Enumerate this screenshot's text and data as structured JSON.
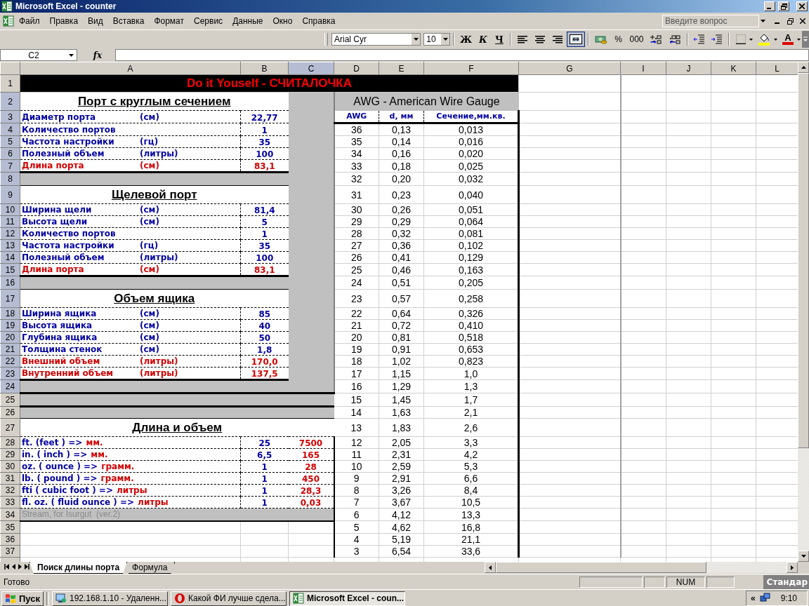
{
  "window": {
    "title": "Microsoft Excel - counter"
  },
  "menu": [
    "Файл",
    "Правка",
    "Вид",
    "Вставка",
    "Формат",
    "Сервис",
    "Данные",
    "Окно",
    "Справка"
  ],
  "help_box": {
    "placeholder": "Введите вопрос"
  },
  "toolbar": {
    "font": "Arial Cyr",
    "size": "10",
    "font_color_label": "А",
    "toggles": [
      {
        "kind": "bold",
        "label": "Ж",
        "on": false
      },
      {
        "kind": "italic",
        "label": "К",
        "on": false
      },
      {
        "kind": "underline",
        "label": "Ч",
        "on": false
      },
      {
        "kind": "align_left",
        "on": false
      },
      {
        "kind": "align_center",
        "on": false
      },
      {
        "kind": "align_right",
        "on": false
      },
      {
        "kind": "merge",
        "on": true
      }
    ],
    "number_buttons": [
      {
        "kind": "currency"
      },
      {
        "kind": "text",
        "label": "%"
      },
      {
        "kind": "text",
        "label": "000"
      },
      {
        "kind": "increase_decimal"
      },
      {
        "kind": "decrease_decimal"
      }
    ]
  },
  "formula_bar": {
    "name_box": "C2",
    "function_label": "fx"
  },
  "sheet": {
    "columns": [
      {
        "label": "A",
        "selected": false
      },
      {
        "label": "B",
        "selected": false
      },
      {
        "label": "C",
        "selected": true
      },
      {
        "label": "D",
        "selected": false
      },
      {
        "label": "E",
        "selected": false
      },
      {
        "label": "F",
        "selected": false
      },
      {
        "label": "G",
        "selected": false
      },
      {
        "label": "I",
        "selected": false
      },
      {
        "label": "J",
        "selected": false
      },
      {
        "label": "K",
        "selected": false
      },
      {
        "label": "L",
        "selected": false
      }
    ],
    "rows": [
      {
        "number": "1",
        "selected": false,
        "kind": "banner",
        "text": "Do it Youself - СЧИТАЛОЧКА"
      },
      {
        "number": "2",
        "selected": true,
        "kind": "heading",
        "text": "Порт с круглым сечением"
      },
      {
        "number": "3",
        "selected": true,
        "kind": "param",
        "label": "Диаметр порта",
        "unit": "(см)",
        "value": "22,77",
        "color": "#0000a0"
      },
      {
        "number": "4",
        "selected": true,
        "kind": "param",
        "label": "Количество портов",
        "value": "1",
        "color": "#0000a0"
      },
      {
        "number": "5",
        "selected": true,
        "kind": "param",
        "label": "Частота настройки",
        "unit": "(гц)",
        "value": "35",
        "color": "#0000a0"
      },
      {
        "number": "6",
        "selected": true,
        "kind": "param",
        "label": "Полезный объем",
        "unit": "(литры)",
        "value": "100",
        "color": "#0000a0"
      },
      {
        "number": "7",
        "selected": true,
        "kind": "param",
        "label": "Длина порта",
        "unit": "(см)",
        "value": "83,1",
        "color": "#d00000"
      },
      {
        "number": "8",
        "selected": true,
        "kind": "spacer"
      },
      {
        "number": "9",
        "selected": true,
        "kind": "heading",
        "text": "Щелевой порт"
      },
      {
        "number": "10",
        "selected": true,
        "kind": "param",
        "label": "Ширина щели",
        "unit": "(см)",
        "value": "81,4",
        "color": "#0000a0"
      },
      {
        "number": "11",
        "selected": true,
        "kind": "param",
        "label": "Высота щели",
        "unit": "(см)",
        "value": "5",
        "color": "#0000a0"
      },
      {
        "number": "12",
        "selected": true,
        "kind": "param",
        "label": "Количество портов",
        "value": "1",
        "color": "#0000a0"
      },
      {
        "number": "13",
        "selected": true,
        "kind": "param",
        "label": "Частота настройки",
        "unit": "(гц)",
        "value": "35",
        "color": "#0000a0"
      },
      {
        "number": "14",
        "selected": true,
        "kind": "param",
        "label": "Полезный объем",
        "unit": "(литры)",
        "value": "100",
        "color": "#0000a0"
      },
      {
        "number": "15",
        "selected": true,
        "kind": "param",
        "label": "Длина порта",
        "unit": "(см)",
        "value": "83,1",
        "color": "#d00000"
      },
      {
        "number": "16",
        "selected": true,
        "kind": "spacer"
      },
      {
        "number": "17",
        "selected": true,
        "kind": "heading",
        "text": "Объем ящика"
      },
      {
        "number": "18",
        "selected": true,
        "kind": "param",
        "label": "Ширина ящика",
        "unit": "(см)",
        "value": "85",
        "color": "#0000a0"
      },
      {
        "number": "19",
        "selected": true,
        "kind": "param",
        "label": "Высота ящика",
        "unit": "(см)",
        "value": "40",
        "color": "#0000a0"
      },
      {
        "number": "20",
        "selected": true,
        "kind": "param",
        "label": "Глубина ящика",
        "unit": "(см)",
        "value": "50",
        "color": "#0000a0"
      },
      {
        "number": "21",
        "selected": true,
        "kind": "param",
        "label": "Толщина стенок",
        "unit": "(см)",
        "value": "1,8",
        "color": "#0000a0"
      },
      {
        "number": "22",
        "selected": true,
        "kind": "param",
        "label": "Внешний объем",
        "unit": "(литры)",
        "value": "170,0",
        "color": "#d00000"
      },
      {
        "number": "23",
        "selected": true,
        "kind": "param",
        "label": "Внутренний объем",
        "unit": "(литры)",
        "value": "137,5",
        "color": "#d00000"
      },
      {
        "number": "24",
        "selected": true,
        "kind": "spacer"
      },
      {
        "number": "25",
        "selected": false,
        "kind": "spacer"
      },
      {
        "number": "26",
        "selected": false,
        "kind": "spacer"
      },
      {
        "number": "27",
        "selected": false,
        "kind": "heading",
        "text": "Длина и объем"
      },
      {
        "number": "28",
        "selected": false,
        "kind": "conversion",
        "source": "ft. (feet ) =>",
        "target": "мм.",
        "input": "25",
        "result": "7500"
      },
      {
        "number": "29",
        "selected": false,
        "kind": "conversion",
        "source": "in. ( inch ) =>",
        "target": "мм.",
        "input": "6,5",
        "result": "165"
      },
      {
        "number": "30",
        "selected": false,
        "kind": "conversion",
        "source": "oz. ( ounce ) =>",
        "target": "грамм.",
        "input": "1",
        "result": "28"
      },
      {
        "number": "31",
        "selected": false,
        "kind": "conversion",
        "source": "lb. ( pound ) =>",
        "target": "грамм.",
        "input": "1",
        "result": "450"
      },
      {
        "number": "32",
        "selected": false,
        "kind": "conversion",
        "source": "fti ( cubic foot ) =>",
        "target": "литры",
        "input": "1",
        "result": "28,3"
      },
      {
        "number": "33",
        "selected": false,
        "kind": "conversion",
        "source": "fl. oz. ( fluid ounce ) =>",
        "target": "литры",
        "input": "1",
        "result": "0,03"
      },
      {
        "number": "34",
        "selected": false,
        "kind": "note",
        "text": "Stream, for Isurgut  (ver.2)"
      },
      {
        "number": "35",
        "selected": false,
        "kind": "blank"
      },
      {
        "number": "36",
        "selected": false,
        "kind": "blank"
      },
      {
        "number": "37",
        "selected": false,
        "kind": "blank"
      }
    ]
  },
  "awg_table": {
    "title": "AWG - American Wire Gauge",
    "columns": [
      "AWG",
      "d, мм",
      "Сечение,мм.кв."
    ],
    "rows": [
      [
        "36",
        "0,13",
        "0,013"
      ],
      [
        "35",
        "0,14",
        "0,016"
      ],
      [
        "34",
        "0,16",
        "0,020"
      ],
      [
        "33",
        "0,18",
        "0,025"
      ],
      [
        "32",
        "0,20",
        "0,032"
      ],
      [
        "31",
        "0,23",
        "0,040"
      ],
      [
        "30",
        "0,26",
        "0,051"
      ],
      [
        "29",
        "0,29",
        "0,064"
      ],
      [
        "28",
        "0,32",
        "0,081"
      ],
      [
        "27",
        "0,36",
        "0,102"
      ],
      [
        "26",
        "0,41",
        "0,129"
      ],
      [
        "25",
        "0,46",
        "0,163"
      ],
      [
        "24",
        "0,51",
        "0,205"
      ],
      [
        "23",
        "0,57",
        "0,258"
      ],
      [
        "22",
        "0,64",
        "0,326"
      ],
      [
        "21",
        "0,72",
        "0,410"
      ],
      [
        "20",
        "0,81",
        "0,518"
      ],
      [
        "19",
        "0,91",
        "0,653"
      ],
      [
        "18",
        "1,02",
        "0,823"
      ],
      [
        "17",
        "1,15",
        "1,0"
      ],
      [
        "16",
        "1,29",
        "1,3"
      ],
      [
        "15",
        "1,45",
        "1,7"
      ],
      [
        "14",
        "1,63",
        "2,1"
      ],
      [
        "13",
        "1,83",
        "2,6"
      ],
      [
        "12",
        "2,05",
        "3,3"
      ],
      [
        "11",
        "2,31",
        "4,2"
      ],
      [
        "10",
        "2,59",
        "5,3"
      ],
      [
        "9",
        "2,91",
        "6,6"
      ],
      [
        "8",
        "3,26",
        "8,4"
      ],
      [
        "7",
        "3,67",
        "10,5"
      ],
      [
        "6",
        "4,12",
        "13,3"
      ],
      [
        "5",
        "4,62",
        "16,8"
      ],
      [
        "4",
        "5,19",
        "21,1"
      ],
      [
        "3",
        "6,54",
        "33,6"
      ]
    ]
  },
  "sheet_tabs": [
    {
      "label": "Поиск длины порта",
      "selected": true
    },
    {
      "label": "Формула",
      "selected": false
    }
  ],
  "status_bar": {
    "text": "Готово",
    "indicators": [
      "NUM"
    ],
    "language_button": "Стандар"
  },
  "taskbar": {
    "start": "Пуск",
    "tasks": [
      {
        "label": "192.168.1.10 - Удаленн...",
        "kind": "remote",
        "selected": false
      },
      {
        "label": "Какой ФИ лучше сдела...",
        "kind": "browser",
        "selected": false
      },
      {
        "label": "Microsoft Excel - coun...",
        "kind": "excel",
        "selected": true
      }
    ],
    "tray": {
      "expand": "«",
      "time": "9:10"
    }
  }
}
